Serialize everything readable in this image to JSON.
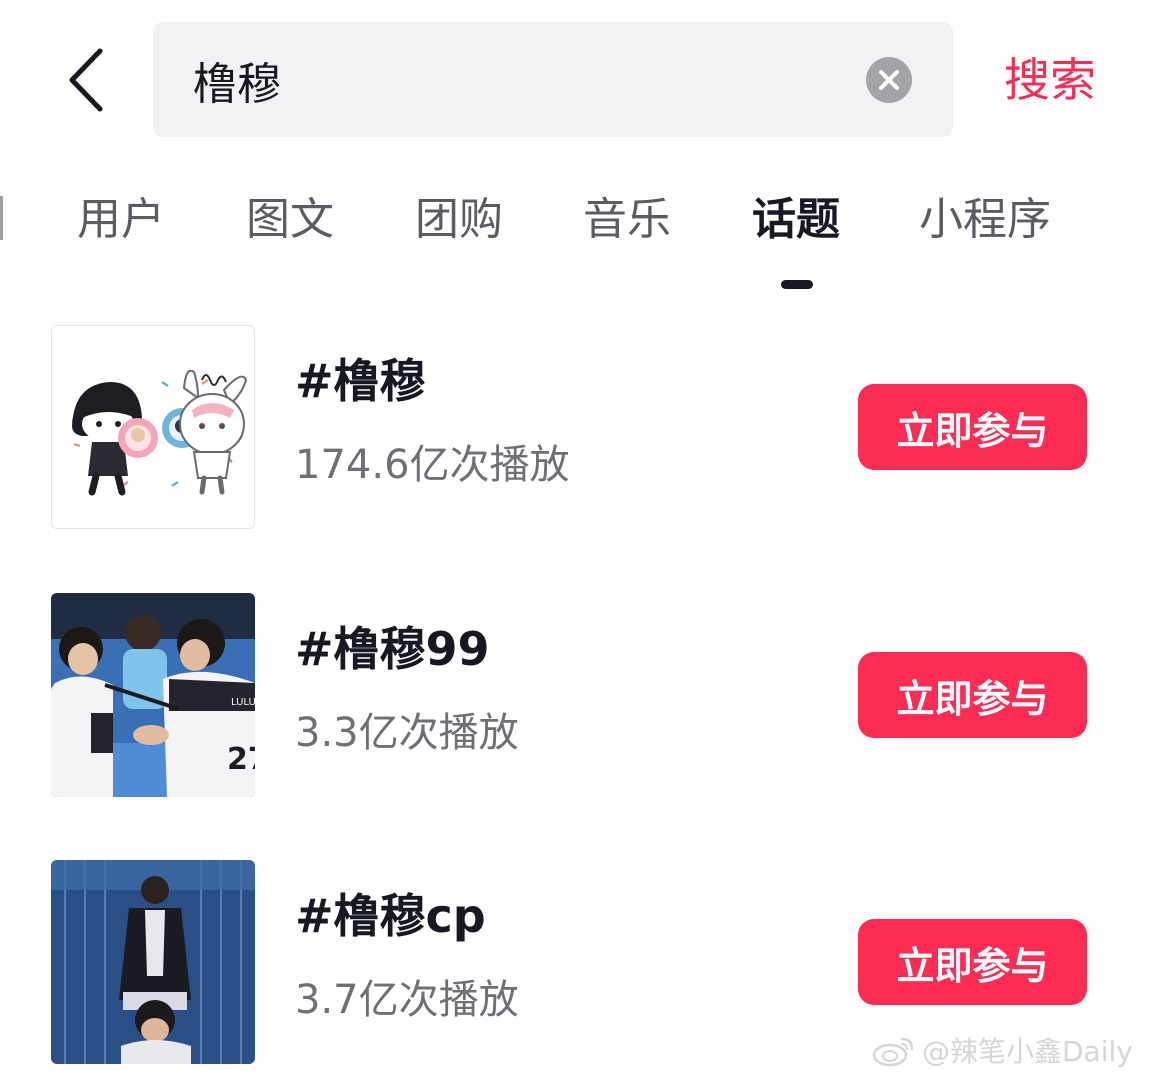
{
  "search": {
    "query": "橹穆",
    "submit_label": "搜索"
  },
  "tabs": [
    {
      "label": "用户",
      "active": false
    },
    {
      "label": "图文",
      "active": false
    },
    {
      "label": "团购",
      "active": false
    },
    {
      "label": "音乐",
      "active": false
    },
    {
      "label": "话题",
      "active": true
    },
    {
      "label": "小程序",
      "active": false
    }
  ],
  "topics": [
    {
      "title": "#橹穆",
      "plays": "174.6亿次播放",
      "join_label": "立即参与",
      "thumb": "illustration"
    },
    {
      "title": "#橹穆99",
      "plays": "3.3亿次播放",
      "join_label": "立即参与",
      "thumb": "photo"
    },
    {
      "title": "#橹穆cp",
      "plays": "3.7亿次播放",
      "join_label": "立即参与",
      "thumb": "photo"
    }
  ],
  "watermark": {
    "text": "@辣笔小鑫Daily"
  },
  "colors": {
    "accent": "#fe2c55",
    "text_primary": "#161823",
    "text_secondary": "#6f7076",
    "search_bg": "#f2f2f4"
  },
  "icons": [
    "back-arrow-icon",
    "clear-icon",
    "weibo-icon"
  ]
}
